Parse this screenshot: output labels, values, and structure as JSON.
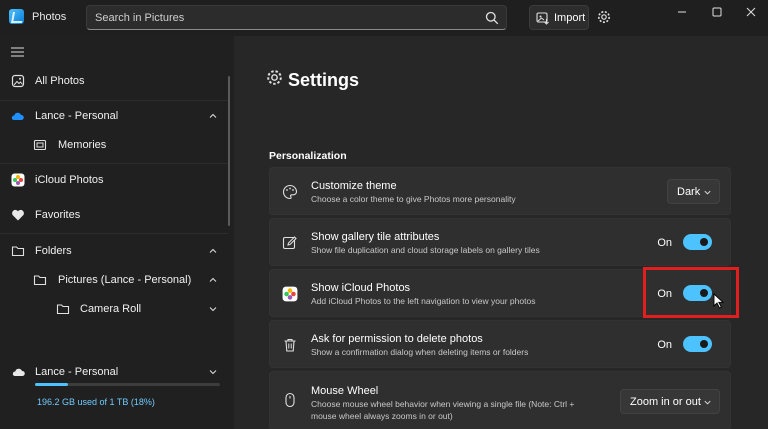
{
  "app": {
    "title": "Photos"
  },
  "search": {
    "placeholder": "Search in Pictures"
  },
  "toolbar": {
    "import_label": "Import"
  },
  "sidebar": {
    "items": [
      {
        "label": "All Photos"
      },
      {
        "label": "Lance - Personal"
      },
      {
        "label": "Memories"
      },
      {
        "label": "iCloud Photos"
      },
      {
        "label": "Favorites"
      },
      {
        "label": "Folders"
      },
      {
        "label": "Pictures (Lance - Personal)"
      },
      {
        "label": "Camera Roll"
      }
    ],
    "account": {
      "label": "Lance - Personal",
      "storage_text": "196.2 GB used of 1 TB (18%)",
      "storage_fraction": 0.18
    }
  },
  "main": {
    "title": "Settings",
    "section": "Personalization",
    "cards": [
      {
        "title": "Customize theme",
        "desc": "Choose a color theme to give Photos more personality",
        "control": "dropdown",
        "value": "Dark"
      },
      {
        "title": "Show gallery tile attributes",
        "desc": "Show file duplication and cloud storage labels on gallery tiles",
        "control": "toggle",
        "state": "On"
      },
      {
        "title": "Show iCloud Photos",
        "desc": "Add iCloud Photos to the left navigation to view your photos",
        "control": "toggle",
        "state": "On"
      },
      {
        "title": "Ask for permission to delete photos",
        "desc": "Show a confirmation dialog when deleting items or folders",
        "control": "toggle",
        "state": "On"
      },
      {
        "title": "Mouse Wheel",
        "desc": "Choose mouse wheel behavior when viewing a single file (Note: Ctrl +",
        "desc2": "mouse wheel always zooms in or out)",
        "control": "dropdown",
        "value": "Zoom in or out"
      }
    ]
  },
  "colors": {
    "accent": "#4cc2ff",
    "highlight": "#e11f1f",
    "background": "#272727"
  },
  "icons": [
    "photos-app-icon",
    "search-icon",
    "import-icon",
    "gear-icon",
    "minimize-icon",
    "maximize-icon",
    "close-icon",
    "hamburger-icon",
    "gallery-icon",
    "onedrive-cloud-icon",
    "memories-icon",
    "icloud-icon",
    "heart-icon",
    "folder-icon",
    "chevron-up-icon",
    "chevron-down-icon",
    "palette-icon",
    "edit-icon",
    "trash-icon",
    "mouse-icon"
  ]
}
